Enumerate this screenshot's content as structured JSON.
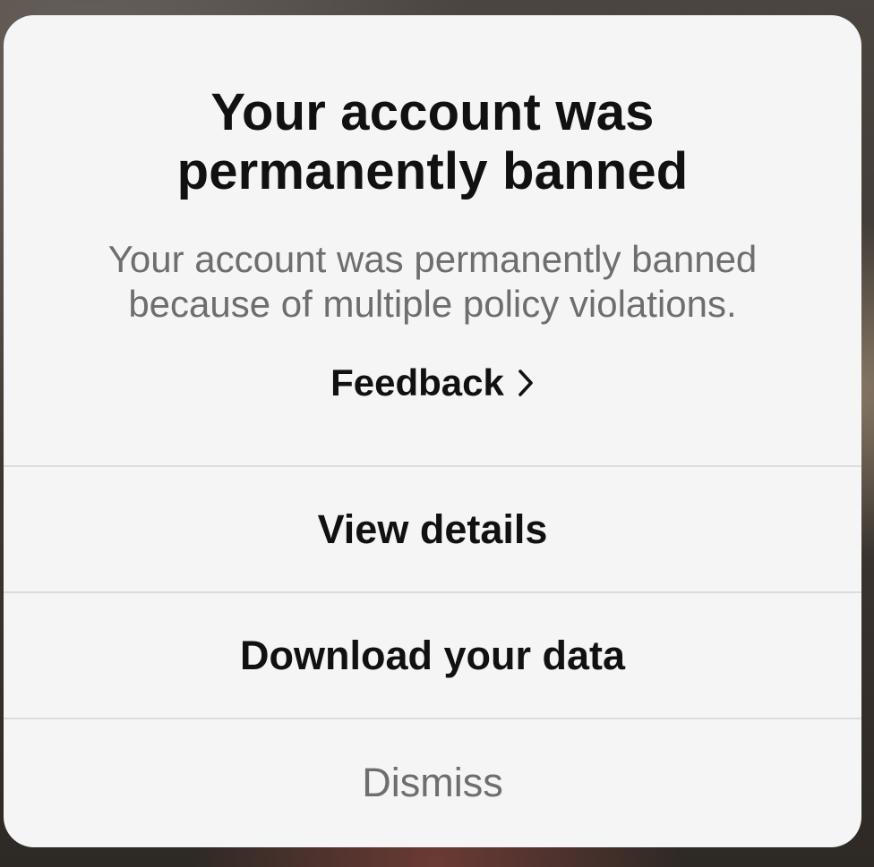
{
  "dialog": {
    "title_line1": "Your account was",
    "title_line2": "permanently banned",
    "message_line1": "Your account was permanently banned",
    "message_line2": "because of multiple policy violations.",
    "feedback_label": "Feedback",
    "feedback_icon": "chevron-right-icon"
  },
  "actions": {
    "view_details": "View details",
    "download_data": "Download your data",
    "dismiss": "Dismiss"
  }
}
